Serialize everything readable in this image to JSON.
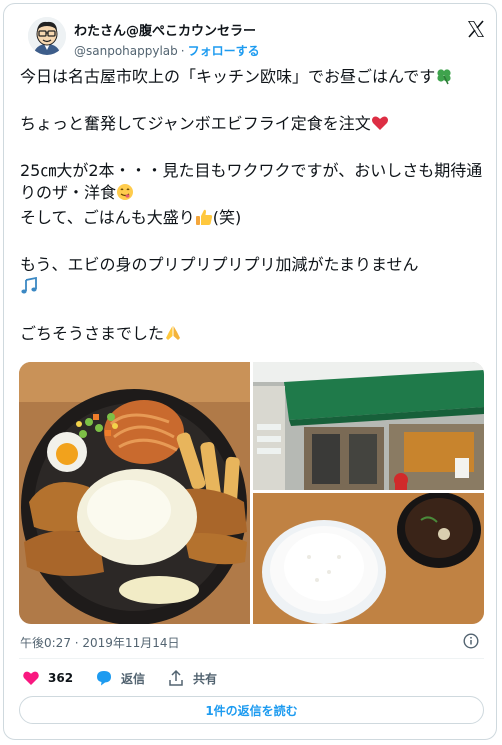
{
  "author": {
    "display_name": "わたさん@腹ぺこカウンセラー",
    "handle": "@sanpohappylab",
    "separator": "·",
    "follow_label": "フォローする"
  },
  "tweet": {
    "line1": "今日は名古屋市吹上の「キッチン欧味」でお昼ごはんです",
    "line2": "ちょっと奮発してジャンボエビフライ定食を注文",
    "line3": "25㎝大が2本・・・見た目もワクワクですが、おいしさも期待通りのザ・洋食",
    "line4": "そして、ごはんも大盛り",
    "line4_suffix": "(笑)",
    "line5": "もう、エビの身のプリプリプリプリ加減がたまりません",
    "line6": "ごちそうさまでした"
  },
  "icons": {
    "clover": "four-leaf-clover-emoji",
    "heart": "red-heart-emoji",
    "yum": "face-savoring-food-emoji",
    "thumbs": "thumbs-up-emoji",
    "notes": "musical-notes-emoji",
    "pray": "folded-hands-emoji"
  },
  "meta": {
    "timestamp": "午後0:27 · 2019年11月14日"
  },
  "actions": {
    "like_count": "362",
    "reply_label": "返信",
    "share_label": "共有"
  },
  "read_replies_label": "1件の返信を読む",
  "colors": {
    "accent": "#1d9bf0",
    "like": "#f91880",
    "muted": "#536471",
    "awning": "#1f7a4a"
  }
}
